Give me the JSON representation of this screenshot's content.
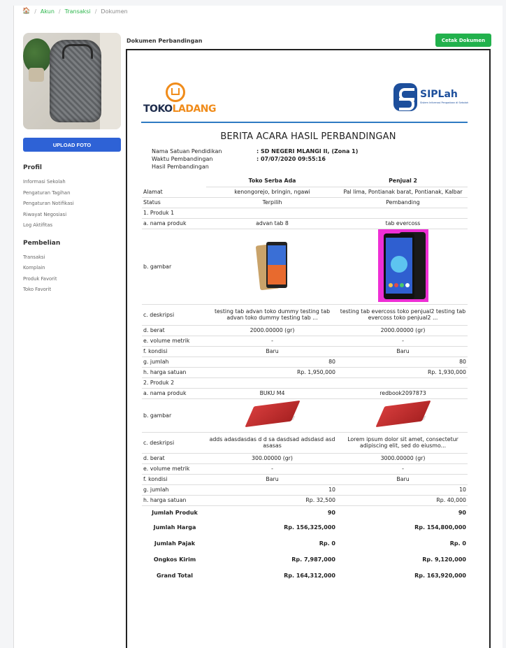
{
  "breadcrumb": {
    "items": [
      "Akun",
      "Transaksi",
      "Dokumen"
    ]
  },
  "sidebar": {
    "upload_label": "UPLOAD FOTO",
    "profil_title": "Profil",
    "profil_items": [
      "Informasi Sekolah",
      "Pengaturan Tagihan",
      "Pengaturan Notifikasi",
      "Riwayat Negosiasi",
      "Log Aktifitas"
    ],
    "pembelian_title": "Pembelian",
    "pembelian_items": [
      "Transaksi",
      "Komplain",
      "Produk Favorit",
      "Toko Favorit"
    ]
  },
  "main": {
    "title": "Dokumen Perbandingan",
    "print_label": "Cetak Dokumen"
  },
  "doc": {
    "logo_left": {
      "part1": "TOKO",
      "part2": "LADANG"
    },
    "logo_right": {
      "name": "SIPLah",
      "sub": "Sistem Informasi Pengadaan di Sekolah"
    },
    "title": "BERITA ACARA HASIL PERBANDINGAN",
    "meta": {
      "satuan_label": "Nama Satuan Pendidikan",
      "satuan_value": ": SD NEGERI MLANGI II, (Zona 1)",
      "waktu_label": "Waktu Pembandingan",
      "waktu_value": ": 07/07/2020 09:55:16",
      "hasil_label": "Hasil Pembandingan"
    },
    "table": {
      "col1": "Toko Serba Ada",
      "col2": "Penjual 2",
      "alamat_label": "Alamat",
      "alamat1": "kenongorejo, bringin, ngawi",
      "alamat2": "Pal lima, Pontianak barat, Pontianak, Kalbar",
      "status_label": "Status",
      "status1": "Terpilih",
      "status2": "Pembanding",
      "p1": {
        "heading": "1.  Produk 1",
        "nama_label": "a.  nama produk",
        "nama1": "advan tab 8",
        "nama2": "tab evercoss",
        "gambar_label": "b.  gambar",
        "desk_label": "c.  deskripsi",
        "desk1": "testing tab advan toko dummy testing tab advan toko dummy testing tab ...",
        "desk2": "testing tab evercoss toko penjual2 testing tab evercoss toko penjual2 ...",
        "berat_label": "d.  berat",
        "berat1": "2000.00000 (gr)",
        "berat2": "2000.00000 (gr)",
        "vol_label": "e.  volume metrik",
        "vol1": "-",
        "vol2": "-",
        "kondisi_label": "f.  kondisi",
        "kondisi1": "Baru",
        "kondisi2": "Baru",
        "jumlah_label": "g.  jumlah",
        "jumlah1": "80",
        "jumlah2": "80",
        "harga_label": "h.  harga satuan",
        "harga1": "Rp. 1,950,000",
        "harga2": "Rp. 1,930,000"
      },
      "p2": {
        "heading": "2.  Produk 2",
        "nama_label": "a.  nama produk",
        "nama1": "BUKU M4",
        "nama2": "redbook2097873",
        "gambar_label": "b.  gambar",
        "desk_label": "c.  deskripsi",
        "desk1": "adds adasdasdas d d sa dasdsad adsdasd asd asasas",
        "desk2": "Lorem ipsum dolor sit amet, consectetur adipiscing elit, sed do eiusmo...",
        "berat_label": "d.  berat",
        "berat1": "300.00000 (gr)",
        "berat2": "3000.00000 (gr)",
        "vol_label": "e.  volume metrik",
        "vol1": "-",
        "vol2": "-",
        "kondisi_label": "f.  kondisi",
        "kondisi1": "Baru",
        "kondisi2": "Baru",
        "jumlah_label": "g.  jumlah",
        "jumlah1": "10",
        "jumlah2": "10",
        "harga_label": "h.  harga satuan",
        "harga1": "Rp. 32,500",
        "harga2": "Rp. 40,000"
      },
      "totals": [
        {
          "label": "Jumlah Produk",
          "v1": "90",
          "v2": "90"
        },
        {
          "label": "Jumlah Harga",
          "v1": "Rp. 156,325,000",
          "v2": "Rp. 154,800,000"
        },
        {
          "label": "Jumlah Pajak",
          "v1": "Rp. 0",
          "v2": "Rp. 0"
        },
        {
          "label": "Ongkos Kirim",
          "v1": "Rp. 7,987,000",
          "v2": "Rp. 9,120,000"
        },
        {
          "label": "Grand Total",
          "v1": "Rp. 164,312,000",
          "v2": "Rp. 163,920,000"
        }
      ]
    }
  },
  "colors": {
    "accent_green": "#22b14c",
    "upload_blue": "#2e62d6",
    "link_green": "#2ab54a",
    "doc_rule": "#2e7ac2",
    "logo_orange": "#f08c1b"
  }
}
